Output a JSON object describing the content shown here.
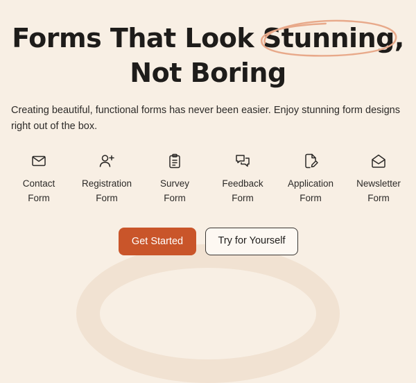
{
  "hero": {
    "title_line1_before": "Forms That Look ",
    "title_line1_highlight": "Stunning",
    "title_line1_after": ",",
    "title_line2": "Not Boring",
    "subtitle": "Creating beautiful, functional forms has never been easier. Enjoy stunning form designs right out of the box."
  },
  "form_types": [
    {
      "icon": "envelope-icon",
      "line1": "Contact",
      "line2": "Form"
    },
    {
      "icon": "user-plus-icon",
      "line1": "Registration",
      "line2": "Form"
    },
    {
      "icon": "clipboard-icon",
      "line1": "Survey",
      "line2": "Form"
    },
    {
      "icon": "chat-bubbles-icon",
      "line1": "Feedback",
      "line2": "Form"
    },
    {
      "icon": "document-edit-icon",
      "line1": "Application",
      "line2": "Form"
    },
    {
      "icon": "open-envelope-icon",
      "line1": "Newsletter",
      "line2": "Form"
    }
  ],
  "buttons": {
    "primary": "Get Started",
    "secondary": "Try for Yourself"
  },
  "colors": {
    "background": "#f8efe4",
    "accent": "#c9552a",
    "highlight_circle": "#e8a98a",
    "text": "#1f1d1b"
  }
}
